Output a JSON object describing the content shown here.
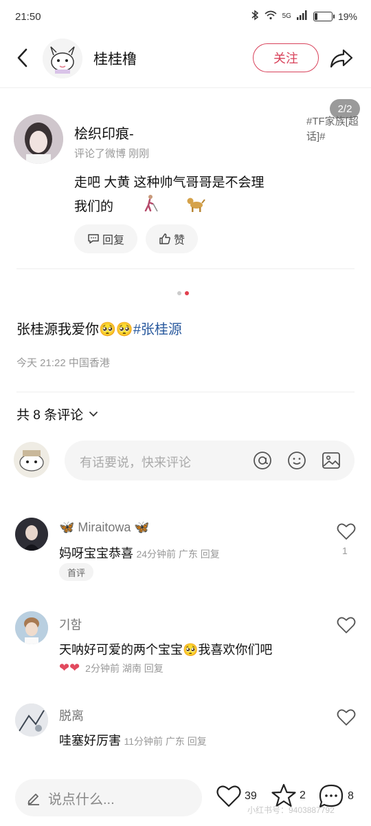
{
  "status": {
    "time": "21:50",
    "battery": "19%",
    "battery_level": 0.19,
    "network": "5G"
  },
  "header": {
    "title": "桂桂橹",
    "follow_label": "关注"
  },
  "card": {
    "page_indicator": "2/2",
    "username": "桧织印痕-",
    "meta": "评论了微博   刚刚",
    "tag": "#TF家族[超话]#",
    "text_line1": "走吧 大黄 这种帅气哥哥是不会理",
    "text_line2": "我们的",
    "reply_label": "回复",
    "like_label": "赞"
  },
  "post": {
    "text": "张桂源我爱你🥺🥺",
    "hashtag": "#张桂源",
    "meta": "今天 21:22  中国香港"
  },
  "comments_header": {
    "title": "共 8 条评论"
  },
  "comment_input": {
    "placeholder": "有话要说，快来评论"
  },
  "comments": [
    {
      "name": "🦋 Miraitowa 🦋",
      "text": "妈呀宝宝恭喜",
      "meta": "24分钟前  广东  回复",
      "likes": "1",
      "badge": "首评"
    },
    {
      "name": "기함",
      "text": "天呐好可爱的两个宝宝🥺我喜欢你们吧",
      "meta_prefix": "❤❤",
      "meta": "2分钟前  湖南  回复",
      "likes": ""
    },
    {
      "name": "脱离",
      "text": "哇塞好厉害",
      "meta": "11分钟前  广东  回复",
      "likes": ""
    }
  ],
  "bottom_bar": {
    "placeholder": "说点什么...",
    "likes": "39",
    "favorites": "2",
    "comments": "8"
  },
  "watermark": "小红书号：9403887792"
}
